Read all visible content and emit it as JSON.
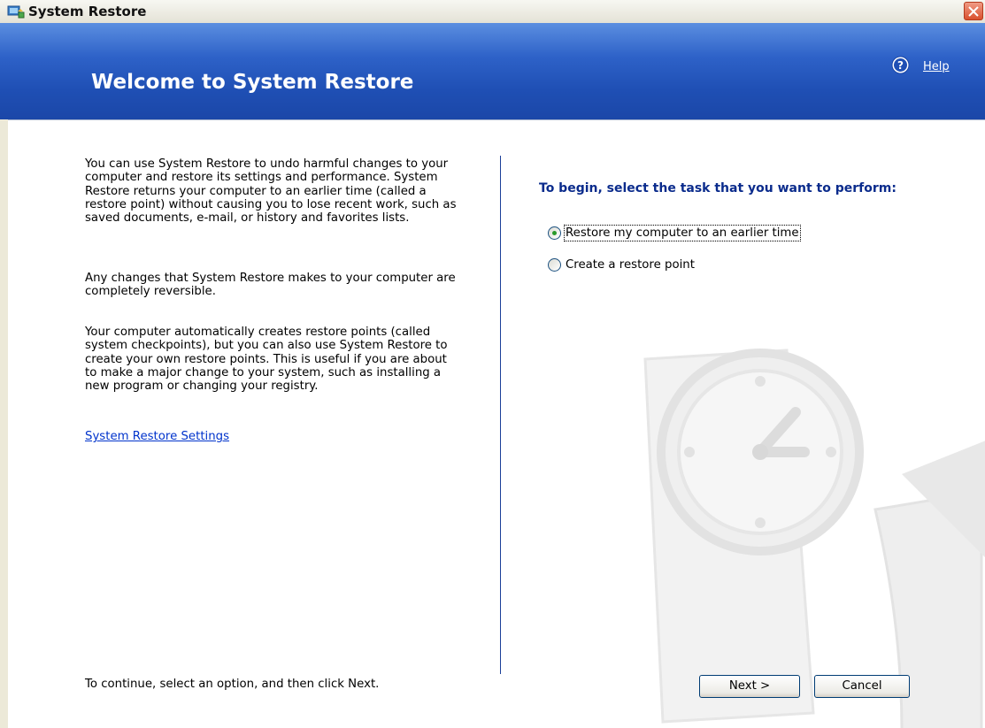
{
  "window": {
    "title": "System Restore"
  },
  "header": {
    "title": "Welcome to System Restore",
    "help_label": "Help"
  },
  "left": {
    "paragraphs": [
      "You can use System Restore to undo harmful changes to your computer and restore its settings and performance. System Restore returns your computer to an earlier time (called a restore point) without causing you to lose recent work, such as saved documents, e-mail, or history and favorites lists.",
      "Any changes that System Restore makes to your computer are completely reversible.",
      "Your computer automatically creates restore points (called system checkpoints), but you can also use System Restore to create your own restore points. This is useful if you are about to make a major change to your system, such as installing a new program or changing your registry."
    ],
    "settings_link": "System Restore Settings",
    "footer_hint": "To continue, select an option, and then click Next."
  },
  "right": {
    "prompt": "To begin, select the task that you want to perform:",
    "options": [
      {
        "label": "Restore my computer to an earlier time",
        "selected": true
      },
      {
        "label": "Create a restore point",
        "selected": false
      }
    ]
  },
  "buttons": {
    "next": "Next >",
    "cancel": "Cancel"
  },
  "icons": {
    "title": "system-restore-icon",
    "close": "close-icon",
    "help": "help-icon",
    "background": "clock-arrow-watermark"
  },
  "colors": {
    "header_blue": "#2e62c8",
    "prompt_blue": "#0a2b8c",
    "link_blue": "#0033cc",
    "divider": "#1c3f99",
    "close_red": "#d9502e"
  }
}
